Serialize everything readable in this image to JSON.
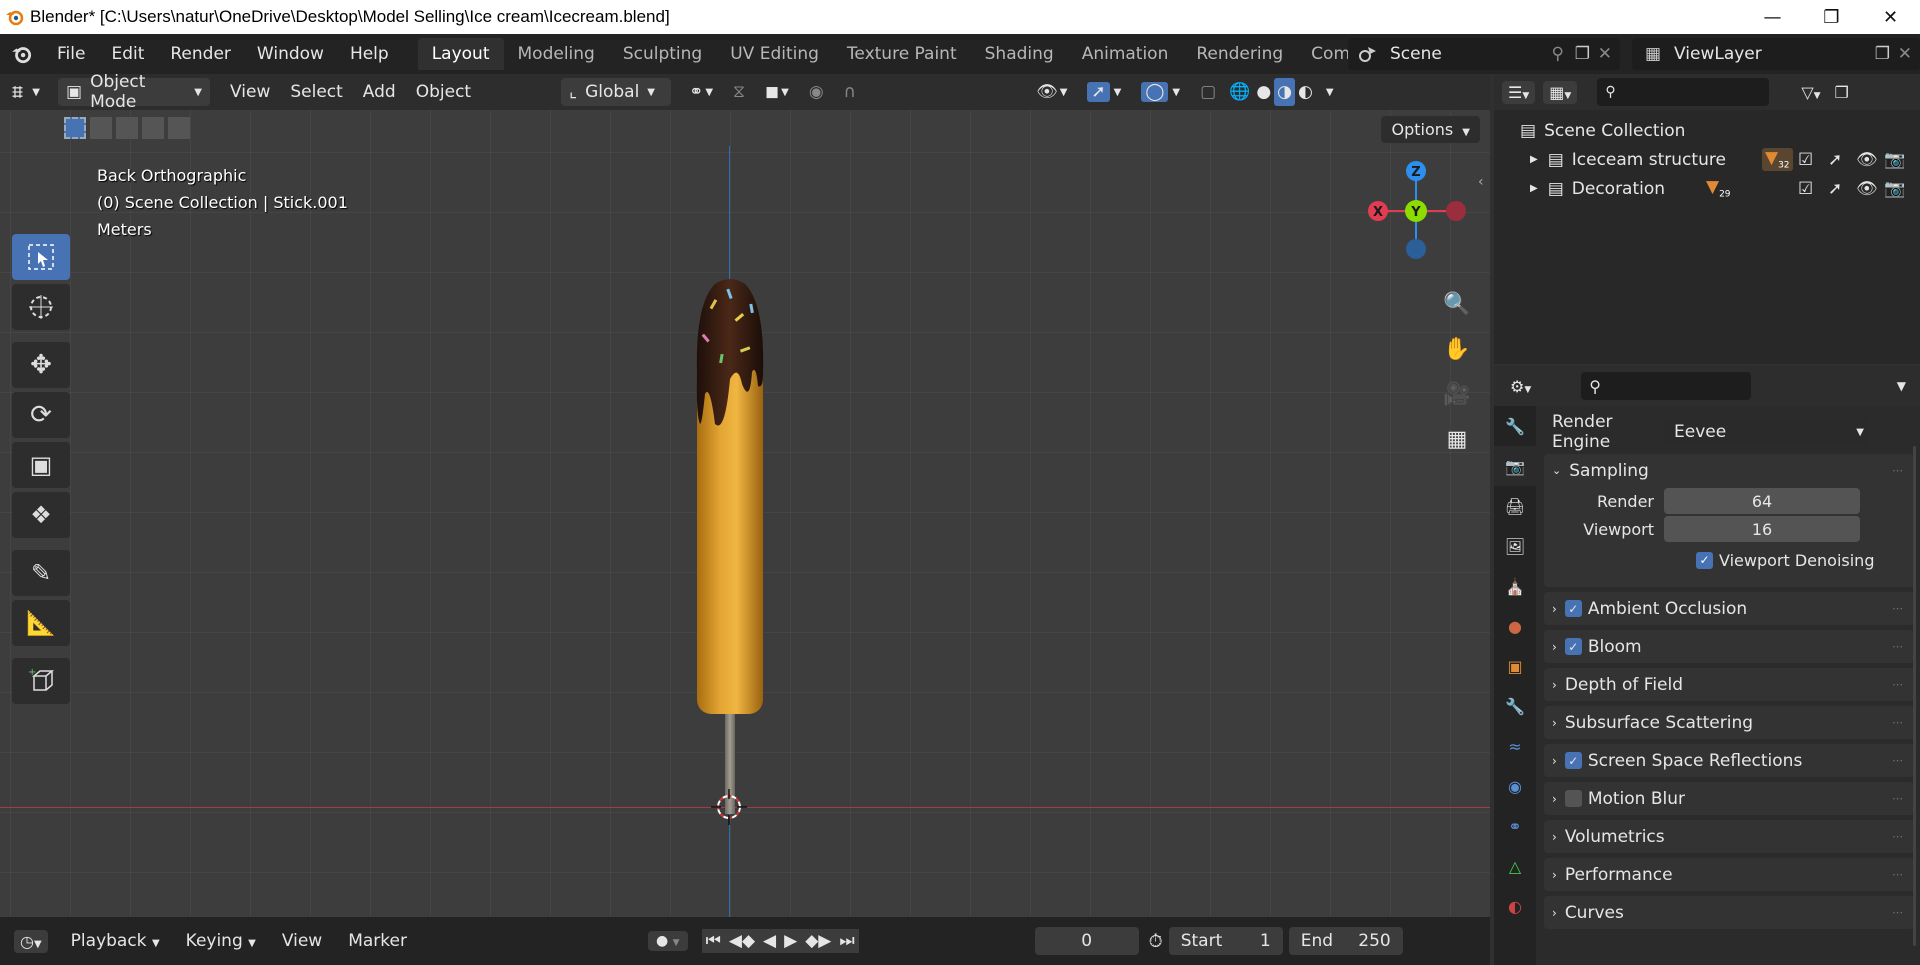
{
  "titlebar": {
    "title": "Blender* [C:\\Users\\natur\\OneDrive\\Desktop\\Model Selling\\Ice cream\\Icecream.blend]"
  },
  "menu": [
    "File",
    "Edit",
    "Render",
    "Window",
    "Help"
  ],
  "workspaces": [
    "Layout",
    "Modeling",
    "Sculpting",
    "UV Editing",
    "Texture Paint",
    "Shading",
    "Animation",
    "Rendering",
    "Compositing"
  ],
  "scene": {
    "name": "Scene",
    "view_layer": "ViewLayer"
  },
  "viewport_header": {
    "mode": "Object Mode",
    "menus": [
      "View",
      "Select",
      "Add",
      "Object"
    ],
    "orientation": "Global",
    "options": "Options"
  },
  "viewport_overlay": {
    "view_name": "Back Orthographic",
    "collection_info": "(0) Scene Collection | Stick.001",
    "units": "Meters"
  },
  "gizmo": {
    "z": "Z",
    "y": "Y",
    "x": "X"
  },
  "outliner": {
    "root": "Scene Collection",
    "items": [
      {
        "label": "Iceceam structure",
        "count": "32"
      },
      {
        "label": "Decoration",
        "count": "29"
      }
    ]
  },
  "properties": {
    "render_engine_label": "Render Engine",
    "render_engine": "Eevee",
    "sampling": {
      "title": "Sampling",
      "render_label": "Render",
      "render_value": "64",
      "viewport_label": "Viewport",
      "viewport_value": "16",
      "denoise_label": "Viewport Denoising"
    },
    "panels": [
      {
        "label": "Ambient Occlusion",
        "checkbox": true,
        "checked": true
      },
      {
        "label": "Bloom",
        "checkbox": true,
        "checked": true
      },
      {
        "label": "Depth of Field",
        "checkbox": false
      },
      {
        "label": "Subsurface Scattering",
        "checkbox": false
      },
      {
        "label": "Screen Space Reflections",
        "checkbox": true,
        "checked": true
      },
      {
        "label": "Motion Blur",
        "checkbox": true,
        "checked": false
      },
      {
        "label": "Volumetrics",
        "checkbox": false
      },
      {
        "label": "Performance",
        "checkbox": false
      },
      {
        "label": "Curves",
        "checkbox": false
      }
    ]
  },
  "timeline": {
    "menus": [
      "Playback",
      "Keying",
      "View",
      "Marker"
    ],
    "current_frame": "0",
    "start_label": "Start",
    "start_value": "1",
    "end_label": "End",
    "end_value": "250"
  },
  "colors": {
    "accent": "#4772b3",
    "x_axis": "#e23c52",
    "y_axis": "#8bdc00",
    "z_axis": "#2c8ff0"
  }
}
